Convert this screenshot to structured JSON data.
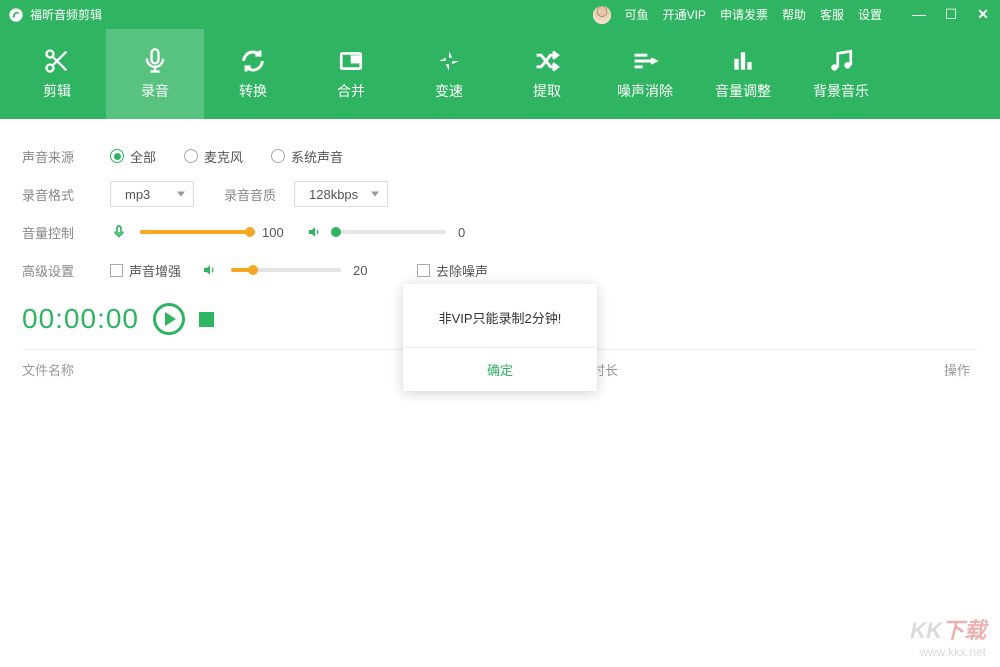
{
  "colors": {
    "primary": "#2fb561",
    "accent_orange": "#f5a623"
  },
  "titlebar": {
    "app_title": "福昕音频剪辑",
    "user_name": "可鱼",
    "links": {
      "vip": "开通VIP",
      "invoice": "申请发票",
      "help": "帮助",
      "service": "客服",
      "settings": "设置"
    }
  },
  "toolbar": {
    "items": [
      {
        "id": "cut",
        "label": "剪辑"
      },
      {
        "id": "record",
        "label": "录音"
      },
      {
        "id": "convert",
        "label": "转换"
      },
      {
        "id": "merge",
        "label": "合并"
      },
      {
        "id": "speed",
        "label": "变速"
      },
      {
        "id": "extract",
        "label": "提取"
      },
      {
        "id": "denoise",
        "label": "噪声消除"
      },
      {
        "id": "volume",
        "label": "音量调整"
      },
      {
        "id": "bgm",
        "label": "背景音乐"
      }
    ],
    "active_index": 1
  },
  "form": {
    "source_label": "声音来源",
    "source_options": {
      "all": "全部",
      "mic": "麦克风",
      "system": "系统声音"
    },
    "source_selected": "all",
    "format_label": "录音格式",
    "format_value": "mp3",
    "quality_label": "录音音质",
    "quality_value": "128kbps",
    "volume_label": "音量控制",
    "mic_volume": {
      "value": 100,
      "max": 100,
      "text": "100"
    },
    "speaker_volume": {
      "value": 0,
      "max": 100,
      "text": "0"
    },
    "advanced_label": "高级设置",
    "enhance_label": "声音增强",
    "enhance_value": {
      "value": 20,
      "max": 100,
      "text": "20"
    },
    "denoise_label": "去除噪声"
  },
  "timer": {
    "text": "00:00:00"
  },
  "table": {
    "name": "文件名称",
    "duration": "时长",
    "operation": "操作"
  },
  "modal": {
    "message": "非VIP只能录制2分钟!",
    "confirm": "确定"
  },
  "watermark": {
    "logo1": "KK",
    "logo2": "下载",
    "url": "www.kkx.net"
  }
}
